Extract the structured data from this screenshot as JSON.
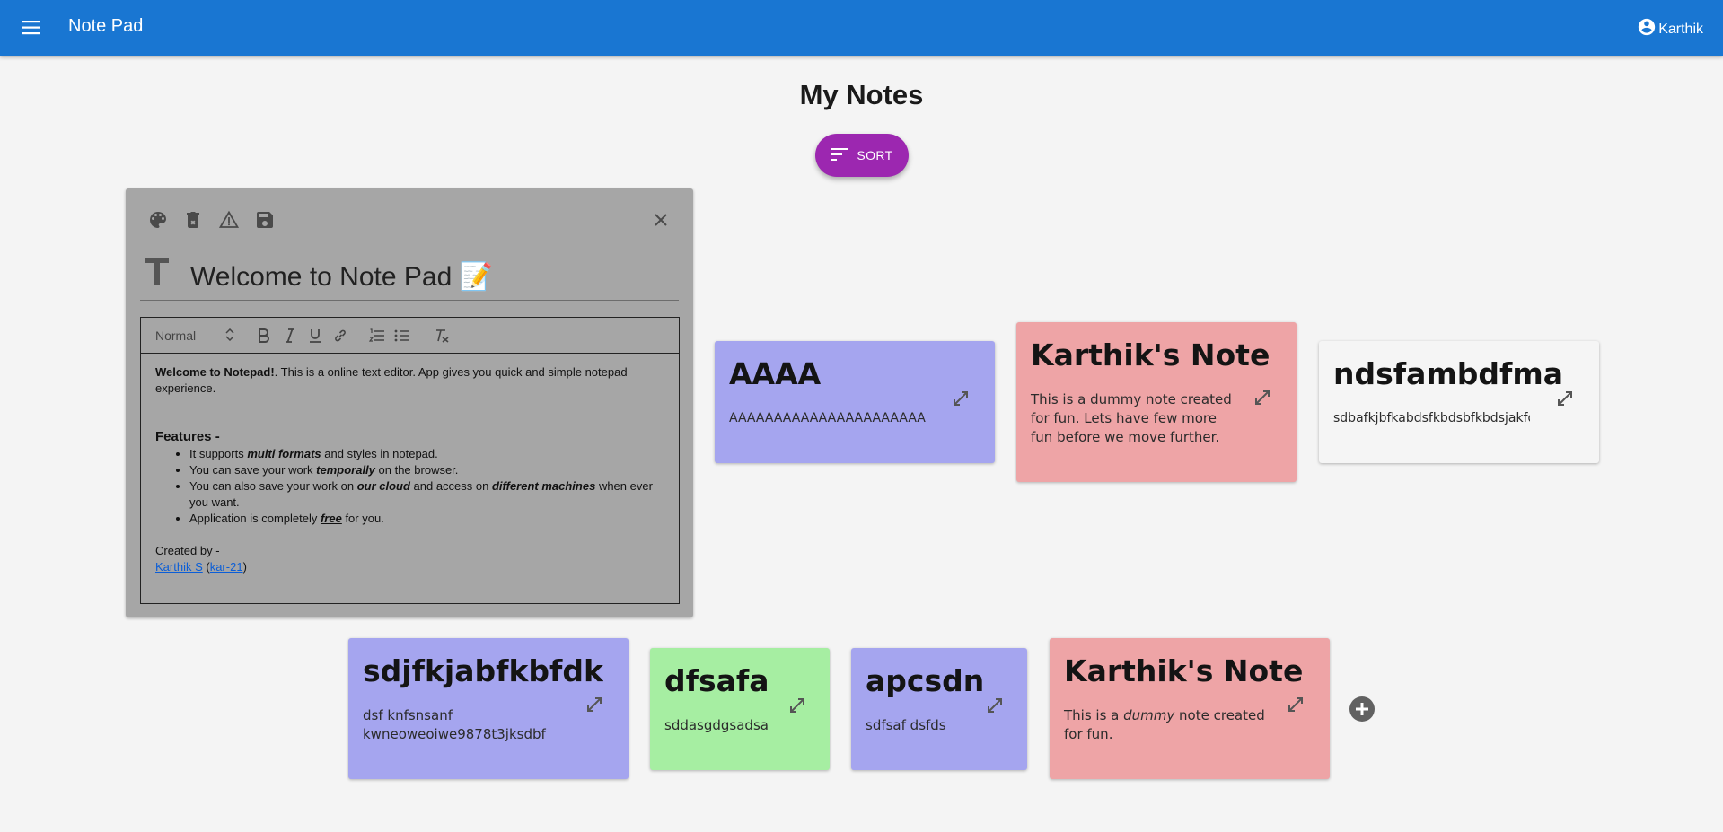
{
  "app": {
    "title": "Note Pad",
    "user_name": "Karthik",
    "menu_icon": "hamburger-menu-icon",
    "user_icon": "account-circle-icon",
    "primary_color": "#1976d2"
  },
  "page": {
    "heading": "My Notes",
    "sort_label": "SORT",
    "sort_color": "#9c27b0"
  },
  "editor": {
    "toolbar_icons": [
      "palette-icon",
      "delete-icon",
      "warning-icon",
      "save-icon",
      "close-icon"
    ],
    "title_icon": "text-t-icon",
    "title": "Welcome to Note Pad 📝",
    "format_select": "Normal",
    "format_buttons": [
      "bold",
      "italic",
      "underline",
      "link",
      "ordered-list",
      "bullet-list",
      "clear-format"
    ],
    "content": {
      "intro_bold": "Welcome to Notepad!",
      "intro_rest": ". This is a online text editor. App gives you quick and simple notepad experience.",
      "features_heading": "Features -",
      "f1_a": "It supports ",
      "f1_em": "multi formats",
      "f1_b": " and styles in notepad.",
      "f2_a": "You can save your work ",
      "f2_em": "temporally",
      "f2_b": " on the browser.",
      "f3_a": "You can also save your work on ",
      "f3_em1": "our cloud",
      "f3_b": " and access on ",
      "f3_em2": "different machines",
      "f3_c": " when ever you want.",
      "f4_a": "Application is completely ",
      "f4_em": "free",
      "f4_b": " for you.",
      "created_by": "Created by -",
      "author_link": "Karthik S",
      "author_open": " (",
      "handle_link": "kar-21",
      "author_close": ")"
    }
  },
  "notes": [
    {
      "title": "AAAA",
      "body": "AAAAAAAAAAAAAAAAAAAAAA",
      "color": "#a5a5ef"
    },
    {
      "title": "Karthik's Note",
      "body": "This is a dummy note created for fun. Lets have few more fun before we move further.",
      "color": "#eea4a6"
    },
    {
      "title": "ndsfambdfma",
      "body": "sdbafkjbfkabdsfkbdsbfkbdsjakfd",
      "color": "#f5f5f5"
    },
    {
      "title": "sdjfkjabfkbfdk",
      "body": "dsf knfsnsanf kwneoweoiwe9878t3jksdbf",
      "color": "#a5a5ef"
    },
    {
      "title": "dfsafa",
      "body": "sddasgdgsadsa",
      "color": "#a6eea2"
    },
    {
      "title": "apcsdn",
      "body": "sdfsaf dsfds",
      "color": "#a5a5ef"
    },
    {
      "title": "Karthik's Note",
      "body_a": "This is a ",
      "body_em": "dummy",
      "body_b": " note created for fun.",
      "color": "#eea4a6"
    }
  ],
  "expand_icon": "expand-diagonal-icon",
  "add_icon": "add-circle-icon"
}
